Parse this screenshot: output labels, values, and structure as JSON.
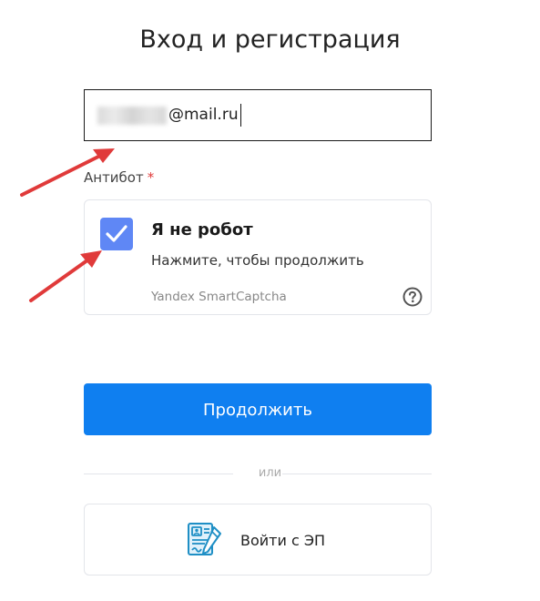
{
  "page": {
    "title": "Вход и регистрация"
  },
  "email_field": {
    "value_visible": "@mail.ru"
  },
  "antibot": {
    "label": "Антибот",
    "required_mark": "*"
  },
  "captcha": {
    "checked": true,
    "title": "Я не робот",
    "subtitle": "Нажмите, чтобы продолжить",
    "brand": "Yandex SmartCaptcha",
    "help_icon": "question-circle-icon"
  },
  "actions": {
    "continue_label": "Продолжить",
    "divider_text": "или",
    "ep_label": "Войти с ЭП",
    "ep_icon": "digital-signature-icon"
  },
  "colors": {
    "primary_button": "#0f7ff0",
    "checkbox": "#5f87f5",
    "required": "#e03a3a",
    "annotation_arrow": "#e03a3a"
  }
}
